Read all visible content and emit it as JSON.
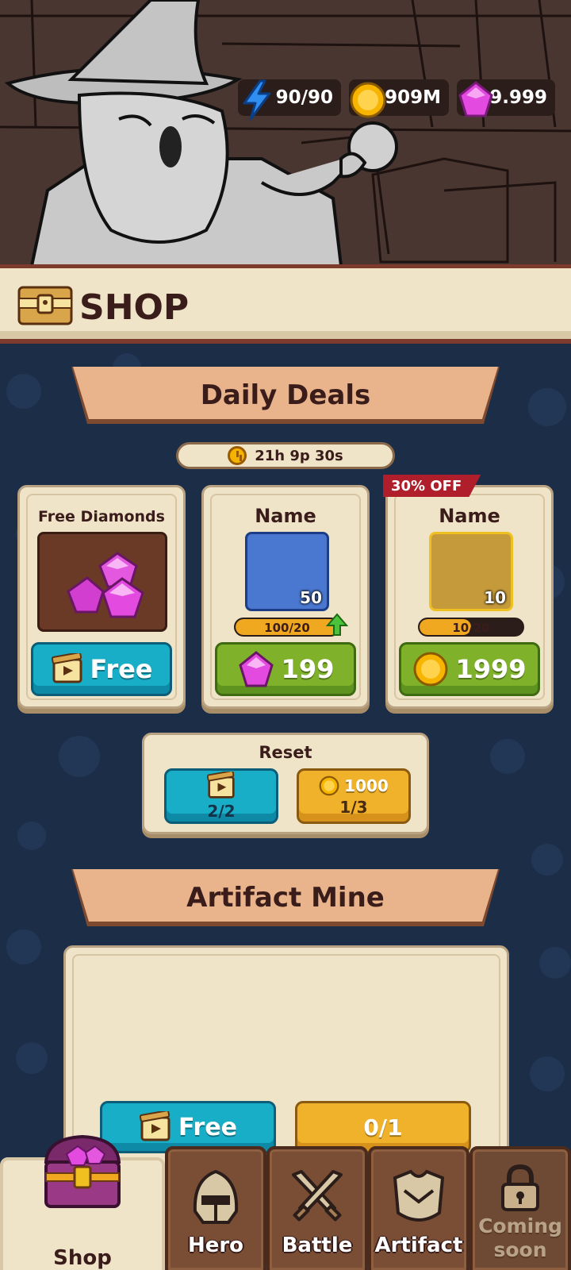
{
  "resources": {
    "energy": "90/90",
    "gold": "909M",
    "diamonds": "9.999"
  },
  "header": {
    "title": "SHOP"
  },
  "daily_deals": {
    "title": "Daily Deals",
    "timer": "21h 9p 30s",
    "cards": [
      {
        "title": "Free Diamonds",
        "button_label": "Free",
        "button_color": "#19aec7"
      },
      {
        "title": "Name",
        "quantity": "50",
        "progress_text": "100/20",
        "progress": 1.0,
        "price": "199",
        "currency": "diamond-icon",
        "item_color": "#4a78d0"
      },
      {
        "title": "Name",
        "quantity": "10",
        "progress_text": "10/20",
        "progress": 0.5,
        "price": "1999",
        "currency": "gold-coin-icon",
        "item_color": "#c59a3a",
        "discount": "30% OFF"
      }
    ],
    "reset": {
      "title": "Reset",
      "ad_count": "2/2",
      "gold_price": "1000",
      "gold_count": "1/3"
    }
  },
  "artifact_mine": {
    "title": "Artifact Mine",
    "free_label": "Free",
    "progress": "0/1"
  },
  "nav": {
    "tabs": [
      {
        "label": "Shop",
        "active": true
      },
      {
        "label": "Hero",
        "active": false
      },
      {
        "label": "Battle",
        "active": false
      },
      {
        "label": "Artifact",
        "active": false
      },
      {
        "label": "Coming soon",
        "active": false,
        "locked": true
      }
    ]
  },
  "colors": {
    "background": "#1c2d47",
    "parchment": "#efe3c8",
    "ribbon": "#e9b48c",
    "text_dark": "#3a1d1a",
    "blue_button": "#19aec7",
    "green_button": "#7fb22a",
    "gold_button": "#f0b22a",
    "discount_red": "#b01d2b"
  }
}
